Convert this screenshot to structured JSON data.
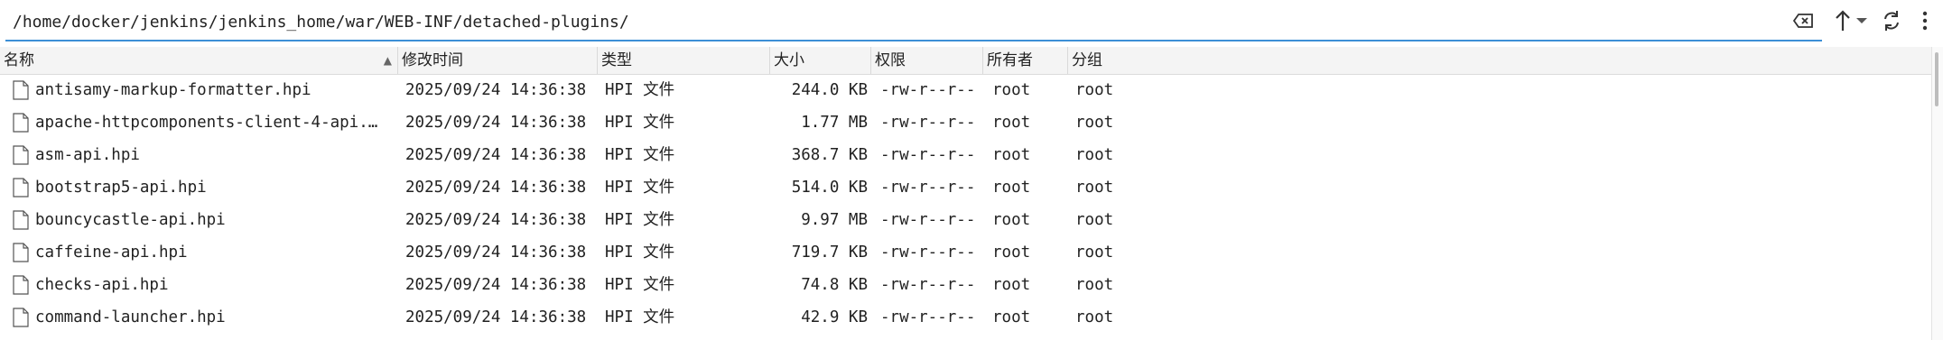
{
  "pathbar": {
    "path": "/home/docker/jenkins/jenkins_home/war/WEB-INF/detached-plugins/",
    "clear_icon": "backspace-clear-icon",
    "up_icon": "arrow-up-icon",
    "dropdown_icon": "chevron-down-icon",
    "refresh_icon": "refresh-icon",
    "menu_icon": "kebab-menu-icon"
  },
  "columns": {
    "name": "名称",
    "modified": "修改时间",
    "type": "类型",
    "size": "大小",
    "permissions": "权限",
    "owner": "所有者",
    "group": "分组",
    "sort_indicator": "▲"
  },
  "files": [
    {
      "name": "antisamy-markup-formatter.hpi",
      "modified": "2025/09/24 14:36:38",
      "type": "HPI 文件",
      "size": "244.0 KB",
      "permissions": "-rw-r--r--",
      "owner": "root",
      "group": "root"
    },
    {
      "name": "apache-httpcomponents-client-4-api.…",
      "modified": "2025/09/24 14:36:38",
      "type": "HPI 文件",
      "size": "1.77 MB",
      "permissions": "-rw-r--r--",
      "owner": "root",
      "group": "root"
    },
    {
      "name": "asm-api.hpi",
      "modified": "2025/09/24 14:36:38",
      "type": "HPI 文件",
      "size": "368.7 KB",
      "permissions": "-rw-r--r--",
      "owner": "root",
      "group": "root"
    },
    {
      "name": "bootstrap5-api.hpi",
      "modified": "2025/09/24 14:36:38",
      "type": "HPI 文件",
      "size": "514.0 KB",
      "permissions": "-rw-r--r--",
      "owner": "root",
      "group": "root"
    },
    {
      "name": "bouncycastle-api.hpi",
      "modified": "2025/09/24 14:36:38",
      "type": "HPI 文件",
      "size": "9.97 MB",
      "permissions": "-rw-r--r--",
      "owner": "root",
      "group": "root"
    },
    {
      "name": "caffeine-api.hpi",
      "modified": "2025/09/24 14:36:38",
      "type": "HPI 文件",
      "size": "719.7 KB",
      "permissions": "-rw-r--r--",
      "owner": "root",
      "group": "root"
    },
    {
      "name": "checks-api.hpi",
      "modified": "2025/09/24 14:36:38",
      "type": "HPI 文件",
      "size": "74.8 KB",
      "permissions": "-rw-r--r--",
      "owner": "root",
      "group": "root"
    },
    {
      "name": "command-launcher.hpi",
      "modified": "2025/09/24 14:36:38",
      "type": "HPI 文件",
      "size": "42.9 KB",
      "permissions": "-rw-r--r--",
      "owner": "root",
      "group": "root"
    }
  ]
}
